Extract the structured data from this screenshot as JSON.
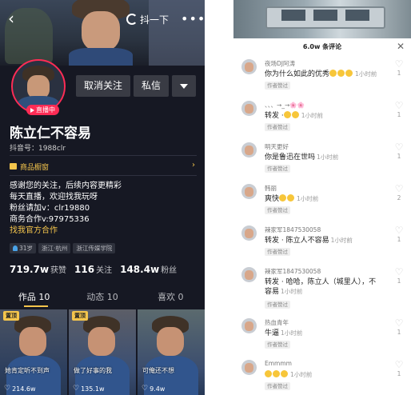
{
  "profile": {
    "nav": {
      "back_icon": "back-arrow-icon",
      "shake_label": "抖一下",
      "more_label": "•••"
    },
    "live_label": "直播中",
    "actions": {
      "unfollow_label": "取消关注",
      "message_label": "私信"
    },
    "name": "陈立仁不容易",
    "douyin_id": "抖音号：1988clr",
    "shop_label": "商品橱窗",
    "bio_lines": [
      "感谢您的关注，后续内容更精彩",
      "每天直播，欢迎找我玩呀",
      "粉丝请加v：clr19880",
      "商务合作v:97975336"
    ],
    "bio_link": "找我官方合作",
    "tags": [
      "31岁",
      "浙江·杭州",
      "浙江传媒学院"
    ],
    "stats": [
      {
        "value": "719.7w",
        "label": "获赞"
      },
      {
        "value": "116",
        "label": "关注"
      },
      {
        "value": "148.4w",
        "label": "粉丝"
      }
    ],
    "tabs": [
      "作品 10",
      "动态 10",
      "喜欢 0"
    ],
    "videos": [
      {
        "pinned": "置顶",
        "caption": "她肯定听不到声",
        "likes": "214.6w"
      },
      {
        "pinned": "置顶",
        "caption": "做了好事的我",
        "likes": "135.1w"
      },
      {
        "pinned": "",
        "caption": "可俺还不想",
        "likes": "9.4w"
      }
    ]
  },
  "comments_panel": {
    "header": "6.0w 条评论",
    "close_icon": "close-icon",
    "comments": [
      {
        "user": "夜场DJ阿涛",
        "text": "你为什么如此的优秀",
        "emoji": 3,
        "time": "1小时前",
        "tag": "作者赞过",
        "likes": "1"
      },
      {
        "user": "、、、→_→🌸🌸",
        "text": "转发 ·",
        "emoji": 2,
        "time": "1小时前",
        "tag": "作者赞过",
        "likes": "1"
      },
      {
        "user": "明天更好",
        "text": "你是鲁迅在世吗",
        "emoji": 0,
        "time": "1小时前",
        "tag": "作者赞过",
        "likes": "1"
      },
      {
        "user": "韩丽",
        "text": "爽快",
        "emoji": 2,
        "time": "1小时前",
        "tag": "作者赞过",
        "likes": "2"
      },
      {
        "user": "辣家军1847530058",
        "text": "转发 · 陈立人不容易",
        "emoji": 0,
        "time": "1小时前",
        "tag": "作者赞过",
        "likes": "1"
      },
      {
        "user": "辣家军1847530058",
        "text": "转发 · 哈哈，陈立人（城里人），不容易",
        "emoji": 0,
        "time": "1小时前",
        "tag": "作者赞过",
        "likes": "1"
      },
      {
        "user": "热血青年",
        "text": "牛逼",
        "emoji": 0,
        "time": "1小时前",
        "tag": "作者赞过",
        "likes": "1"
      },
      {
        "user": "Emmmm",
        "text": "",
        "emoji": 3,
        "time": "1小时前",
        "tag": "作者赞过",
        "likes": "1"
      }
    ]
  }
}
